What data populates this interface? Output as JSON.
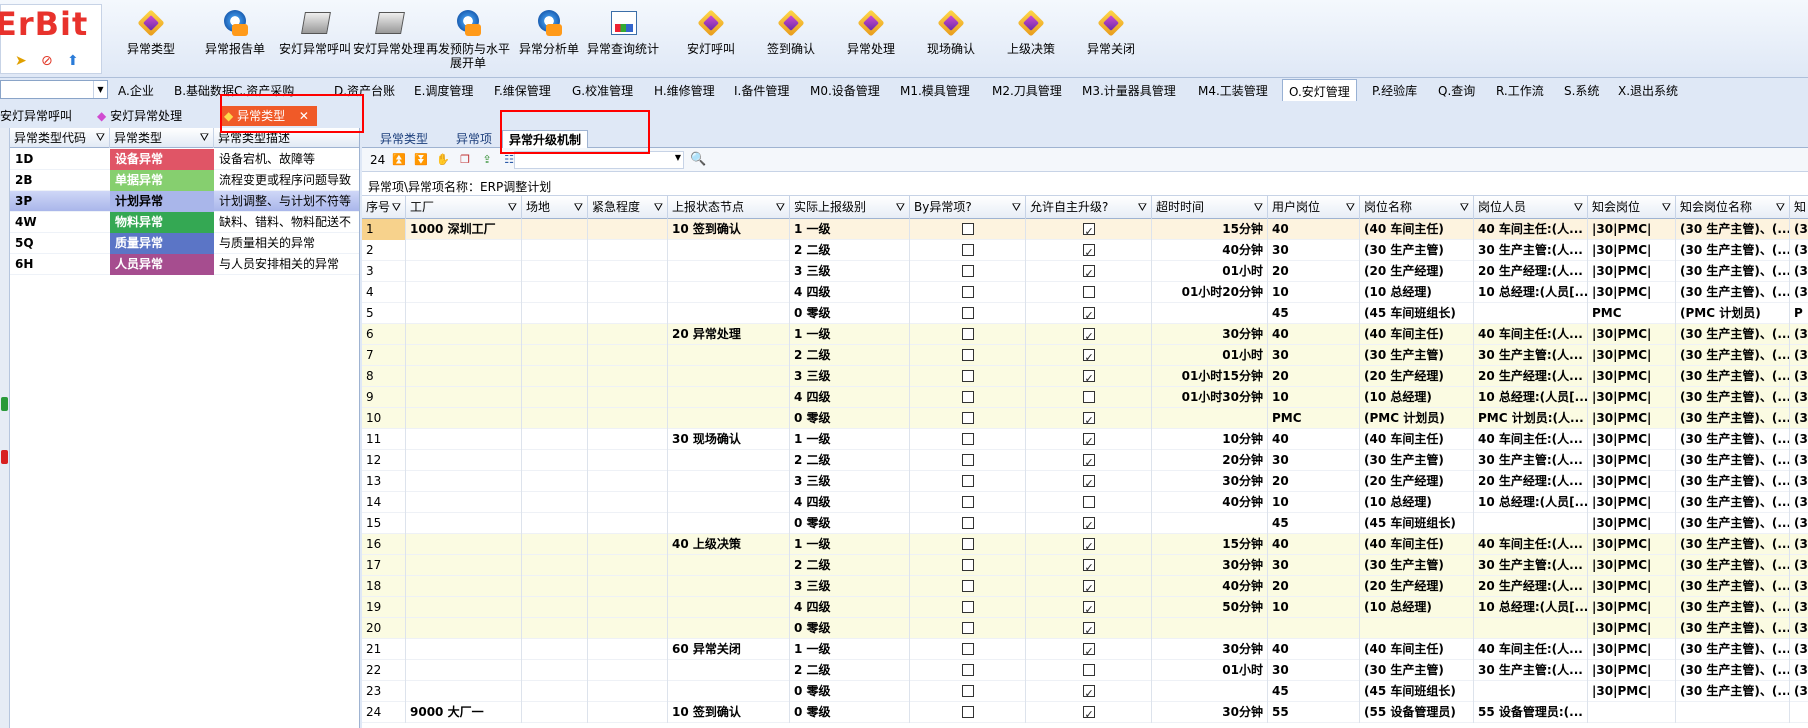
{
  "app": {
    "logo_text": "ErBit",
    "colors": {
      "accent": "#f05a28",
      "selection": "#a9b6ea",
      "frame": "#dfe8f6",
      "redbox": "#ff0000"
    }
  },
  "toolbar": {
    "buttons": [
      {
        "label": "异常类型",
        "icon": "cube-icon"
      },
      {
        "label": "异常报告单",
        "icon": "report-icon"
      },
      {
        "label": "安灯异常呼叫",
        "icon": "printer-icon"
      },
      {
        "label": "安灯异常处理",
        "icon": "printer-icon"
      },
      {
        "label": "再发预防与水平展开单",
        "icon": "report-icon"
      },
      {
        "label": "异常分析单",
        "icon": "report-icon"
      },
      {
        "label": "异常查询统计",
        "icon": "chart-icon"
      },
      {
        "label": "安灯呼叫",
        "icon": "cube-icon"
      },
      {
        "label": "签到确认",
        "icon": "cube-icon"
      },
      {
        "label": "异常处理",
        "icon": "cube-icon"
      },
      {
        "label": "现场确认",
        "icon": "cube-icon"
      },
      {
        "label": "上级决策",
        "icon": "cube-icon"
      },
      {
        "label": "异常关闭",
        "icon": "cube-icon"
      }
    ]
  },
  "menubar": {
    "combo_value": "",
    "items": [
      "A.企业",
      "B.基础数据",
      "C.资产采购",
      "D.资产台账",
      "E.调度管理",
      "F.维保管理",
      "G.校准管理",
      "H.维修管理",
      "I.备件管理",
      "M0.设备管理",
      "M1.模具管理",
      "M2.刀具管理",
      "M3.计量器具管理",
      "M4.工装管理",
      "O.安灯管理",
      "P.经验库",
      "Q.查询",
      "R.工作流",
      "S.系统",
      "X.退出系统"
    ],
    "active": "O.安灯管理"
  },
  "doc_tabs": {
    "items": [
      "安灯异常呼叫",
      "安灯异常处理",
      "异常类型"
    ],
    "close_symbol": "✕"
  },
  "left_grid": {
    "headers": [
      "异常类型代码",
      "异常类型",
      "异常类型描述"
    ],
    "rows": [
      {
        "code": "1D",
        "type": "设备异常",
        "desc": "设备宕机、故障等",
        "color": "#e05566"
      },
      {
        "code": "2B",
        "type": "单据异常",
        "desc": "流程变更或程序问题导致",
        "color": "#86cf6f"
      },
      {
        "code": "3P",
        "type": "计划异常",
        "desc": "计划调整、与计划不符等",
        "color": "#a9b6ea"
      },
      {
        "code": "4W",
        "type": "物料异常",
        "desc": "缺料、错料、物料配送不",
        "color": "#34a853"
      },
      {
        "code": "5Q",
        "type": "质量异常",
        "desc": "与质量相关的异常",
        "color": "#5b75c6"
      },
      {
        "code": "6H",
        "type": "人员异常",
        "desc": "与人员安排相关的异常",
        "color": "#a64d8f"
      }
    ]
  },
  "sub_tabs": {
    "items": [
      "异常类型",
      "异常项",
      "异常升级机制"
    ],
    "active": "异常升级机制"
  },
  "nav": {
    "count": "24",
    "combo_value": ""
  },
  "breadcrumb": {
    "text": "异常项\\异常项名称：ERP调整计划"
  },
  "grid": {
    "headers": [
      "序号",
      "工厂",
      "场地",
      "紧急程度",
      "上报状态节点",
      "实际上报级别",
      "By异常项?",
      "允许自主升级?",
      "超时时间",
      "用户岗位",
      "岗位名称",
      "岗位人员",
      "知会岗位",
      "知会岗位名称",
      "知"
    ],
    "rows": [
      {
        "seq": "1",
        "factory": "1000 深圳工厂",
        "node": "10 签到确认",
        "level": "1 一级",
        "by": false,
        "allow": true,
        "timeout": "15分钟",
        "post": "40",
        "post_name": "(40 车间主任)",
        "person": "40 车间主任:(人...",
        "notify": "|30|PMC|",
        "notify_name": "(30 生产主管)、(...",
        "extra": "(3"
      },
      {
        "seq": "2",
        "factory": "",
        "node": "",
        "level": "2 二级",
        "by": false,
        "allow": true,
        "timeout": "40分钟",
        "post": "30",
        "post_name": "(30 生产主管)",
        "person": "30 生产主管:(人...",
        "notify": "|30|PMC|",
        "notify_name": "(30 生产主管)、(...",
        "extra": "(3"
      },
      {
        "seq": "3",
        "factory": "",
        "node": "",
        "level": "3 三级",
        "by": false,
        "allow": true,
        "timeout": "01小时",
        "post": "20",
        "post_name": "(20 生产经理)",
        "person": "20 生产经理:(人...",
        "notify": "|30|PMC|",
        "notify_name": "(30 生产主管)、(...",
        "extra": "(3"
      },
      {
        "seq": "4",
        "factory": "",
        "node": "",
        "level": "4 四级",
        "by": false,
        "allow": false,
        "timeout": "01小时20分钟",
        "post": "10",
        "post_name": "(10 总经理)",
        "person": "10 总经理:(人员[...",
        "notify": "|30|PMC|",
        "notify_name": "(30 生产主管)、(...",
        "extra": "(3"
      },
      {
        "seq": "5",
        "factory": "",
        "node": "",
        "level": "0 零级",
        "by": false,
        "allow": true,
        "timeout": "",
        "post": "45",
        "post_name": "(45 车间班组长)",
        "person": "",
        "notify": "PMC",
        "notify_name": "(PMC 计划员)",
        "extra": "P"
      },
      {
        "seq": "6",
        "factory": "",
        "node": "20 异常处理",
        "level": "1 一级",
        "by": false,
        "allow": true,
        "timeout": "30分钟",
        "post": "40",
        "post_name": "(40 车间主任)",
        "person": "40 车间主任:(人...",
        "notify": "|30|PMC|",
        "notify_name": "(30 生产主管)、(...",
        "extra": "(3"
      },
      {
        "seq": "7",
        "factory": "",
        "node": "",
        "level": "2 二级",
        "by": false,
        "allow": true,
        "timeout": "01小时",
        "post": "30",
        "post_name": "(30 生产主管)",
        "person": "30 生产主管:(人...",
        "notify": "|30|PMC|",
        "notify_name": "(30 生产主管)、(...",
        "extra": "(3"
      },
      {
        "seq": "8",
        "factory": "",
        "node": "",
        "level": "3 三级",
        "by": false,
        "allow": true,
        "timeout": "01小时15分钟",
        "post": "20",
        "post_name": "(20 生产经理)",
        "person": "20 生产经理:(人...",
        "notify": "|30|PMC|",
        "notify_name": "(30 生产主管)、(...",
        "extra": "(3"
      },
      {
        "seq": "9",
        "factory": "",
        "node": "",
        "level": "4 四级",
        "by": false,
        "allow": false,
        "timeout": "01小时30分钟",
        "post": "10",
        "post_name": "(10 总经理)",
        "person": "10 总经理:(人员[...",
        "notify": "|30|PMC|",
        "notify_name": "(30 生产主管)、(...",
        "extra": "(3"
      },
      {
        "seq": "10",
        "factory": "",
        "node": "",
        "level": "0 零级",
        "by": false,
        "allow": true,
        "timeout": "",
        "post": "PMC",
        "post_name": "(PMC 计划员)",
        "person": "PMC 计划员:(人...",
        "notify": "|30|PMC|",
        "notify_name": "(30 生产主管)、(...",
        "extra": "(3"
      },
      {
        "seq": "11",
        "factory": "",
        "node": "30 现场确认",
        "level": "1 一级",
        "by": false,
        "allow": true,
        "timeout": "10分钟",
        "post": "40",
        "post_name": "(40 车间主任)",
        "person": "40 车间主任:(人...",
        "notify": "|30|PMC|",
        "notify_name": "(30 生产主管)、(...",
        "extra": "(3"
      },
      {
        "seq": "12",
        "factory": "",
        "node": "",
        "level": "2 二级",
        "by": false,
        "allow": true,
        "timeout": "20分钟",
        "post": "30",
        "post_name": "(30 生产主管)",
        "person": "30 生产主管:(人...",
        "notify": "|30|PMC|",
        "notify_name": "(30 生产主管)、(...",
        "extra": "(3"
      },
      {
        "seq": "13",
        "factory": "",
        "node": "",
        "level": "3 三级",
        "by": false,
        "allow": true,
        "timeout": "30分钟",
        "post": "20",
        "post_name": "(20 生产经理)",
        "person": "20 生产经理:(人...",
        "notify": "|30|PMC|",
        "notify_name": "(30 生产主管)、(...",
        "extra": "(3"
      },
      {
        "seq": "14",
        "factory": "",
        "node": "",
        "level": "4 四级",
        "by": false,
        "allow": false,
        "timeout": "40分钟",
        "post": "10",
        "post_name": "(10 总经理)",
        "person": "10 总经理:(人员[...",
        "notify": "|30|PMC|",
        "notify_name": "(30 生产主管)、(...",
        "extra": "(3"
      },
      {
        "seq": "15",
        "factory": "",
        "node": "",
        "level": "0 零级",
        "by": false,
        "allow": true,
        "timeout": "",
        "post": "45",
        "post_name": "(45 车间班组长)",
        "person": "",
        "notify": "|30|PMC|",
        "notify_name": "(30 生产主管)、(...",
        "extra": "(3"
      },
      {
        "seq": "16",
        "factory": "",
        "node": "40 上级决策",
        "level": "1 一级",
        "by": false,
        "allow": true,
        "timeout": "15分钟",
        "post": "40",
        "post_name": "(40 车间主任)",
        "person": "40 车间主任:(人...",
        "notify": "|30|PMC|",
        "notify_name": "(30 生产主管)、(...",
        "extra": "(3"
      },
      {
        "seq": "17",
        "factory": "",
        "node": "",
        "level": "2 二级",
        "by": false,
        "allow": true,
        "timeout": "30分钟",
        "post": "30",
        "post_name": "(30 生产主管)",
        "person": "30 生产主管:(人...",
        "notify": "|30|PMC|",
        "notify_name": "(30 生产主管)、(...",
        "extra": "(3"
      },
      {
        "seq": "18",
        "factory": "",
        "node": "",
        "level": "3 三级",
        "by": false,
        "allow": true,
        "timeout": "40分钟",
        "post": "20",
        "post_name": "(20 生产经理)",
        "person": "20 生产经理:(人...",
        "notify": "|30|PMC|",
        "notify_name": "(30 生产主管)、(...",
        "extra": "(3"
      },
      {
        "seq": "19",
        "factory": "",
        "node": "",
        "level": "4 四级",
        "by": false,
        "allow": true,
        "timeout": "50分钟",
        "post": "10",
        "post_name": "(10 总经理)",
        "person": "10 总经理:(人员[...",
        "notify": "|30|PMC|",
        "notify_name": "(30 生产主管)、(...",
        "extra": "(3"
      },
      {
        "seq": "20",
        "factory": "",
        "node": "",
        "level": "0 零级",
        "by": false,
        "allow": true,
        "timeout": "",
        "post": "",
        "post_name": "",
        "person": "",
        "notify": "|30|PMC|",
        "notify_name": "(30 生产主管)、(...",
        "extra": "(3"
      },
      {
        "seq": "21",
        "factory": "",
        "node": "60 异常关闭",
        "level": "1 一级",
        "by": false,
        "allow": true,
        "timeout": "30分钟",
        "post": "40",
        "post_name": "(40 车间主任)",
        "person": "40 车间主任:(人...",
        "notify": "|30|PMC|",
        "notify_name": "(30 生产主管)、(...",
        "extra": "(3"
      },
      {
        "seq": "22",
        "factory": "",
        "node": "",
        "level": "2 二级",
        "by": false,
        "allow": false,
        "timeout": "01小时",
        "post": "30",
        "post_name": "(30 生产主管)",
        "person": "30 生产主管:(人...",
        "notify": "|30|PMC|",
        "notify_name": "(30 生产主管)、(...",
        "extra": "(3"
      },
      {
        "seq": "23",
        "factory": "",
        "node": "",
        "level": "0 零级",
        "by": false,
        "allow": true,
        "timeout": "",
        "post": "45",
        "post_name": "(45 车间班组长)",
        "person": "",
        "notify": "|30|PMC|",
        "notify_name": "(30 生产主管)、(...",
        "extra": "(3"
      },
      {
        "seq": "24",
        "factory": "9000 大厂一",
        "node": "10 签到确认",
        "level": "0 零级",
        "by": false,
        "allow": true,
        "timeout": "30分钟",
        "post": "55",
        "post_name": "(55 设备管理员)",
        "person": "55 设备管理员:(...",
        "notify": "",
        "notify_name": "",
        "extra": ""
      }
    ]
  }
}
